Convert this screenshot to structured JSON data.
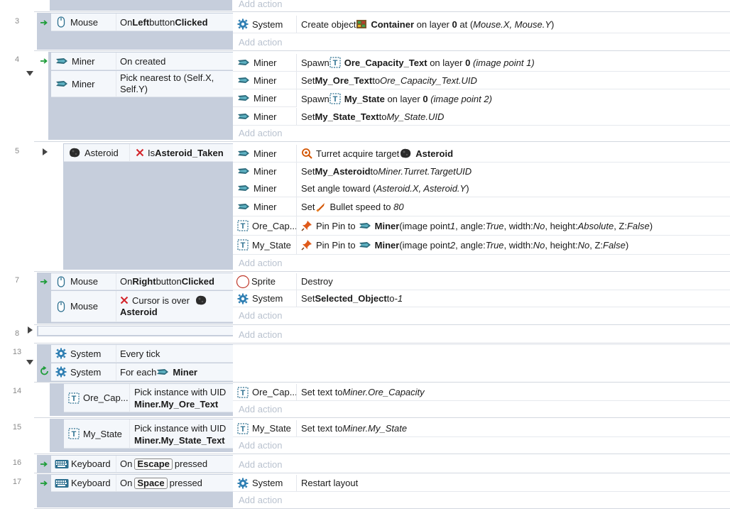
{
  "colors": {
    "accent_green": "#1f9d3a",
    "gear": "#2f7fb3",
    "add_action": "#b9c2cf",
    "line_number": "#8a8a8a"
  },
  "top_add_action": "Add action",
  "events": [
    {
      "num": "3",
      "conditions": [
        {
          "object": "Mouse",
          "icon": "mouse-icon",
          "text": [
            "On ",
            "Left",
            " button ",
            "Clicked"
          ]
        }
      ],
      "actions": [
        {
          "object": "System",
          "icon": "gear-icon",
          "text": [
            "Create object ",
            "Container",
            " on layer ",
            "0",
            " at (",
            "Mouse.X, Mouse.Y",
            ")"
          ]
        }
      ],
      "add_action": "Add action"
    },
    {
      "num": "4",
      "conditions": [
        {
          "object": "Miner",
          "icon": "miner-icon",
          "text": [
            "On created"
          ]
        },
        {
          "object": "Miner",
          "icon": "miner-icon",
          "text": [
            "Pick nearest to (Self.X, Self.Y)"
          ]
        }
      ],
      "actions": [
        {
          "object": "Miner",
          "icon": "miner-icon",
          "text": [
            "Spawn ",
            "Ore_Capacity_Text",
            " on layer ",
            "0",
            " (image point 1)"
          ]
        },
        {
          "object": "Miner",
          "icon": "miner-icon",
          "text": [
            "Set ",
            "My_Ore_Text",
            " to ",
            "Ore_Capacity_Text.UID"
          ]
        },
        {
          "object": "Miner",
          "icon": "miner-icon",
          "text": [
            "Spawn ",
            "My_State",
            " on layer ",
            "0",
            " (image point 2)"
          ]
        },
        {
          "object": "Miner",
          "icon": "miner-icon",
          "text": [
            "Set ",
            "My_State_Text",
            " to ",
            "My_State.UID"
          ]
        }
      ],
      "add_action": "Add action"
    },
    {
      "num": "5",
      "conditions": [
        {
          "object": "Asteroid",
          "icon": "asteroid-icon",
          "text": [
            "Is ",
            "Asteroid_Taken"
          ]
        }
      ],
      "actions": [
        {
          "object": "Miner",
          "icon": "miner-icon",
          "text": [
            "Turret acquire target ",
            "Asteroid"
          ]
        },
        {
          "object": "Miner",
          "icon": "miner-icon",
          "text": [
            "Set ",
            "My_Asteroid",
            " to ",
            "Miner.Turret.TargetUID"
          ]
        },
        {
          "object": "Miner",
          "icon": "miner-icon",
          "text": [
            "Set angle toward (",
            "Asteroid.X, Asteroid.Y",
            ")"
          ]
        },
        {
          "object": "Miner",
          "icon": "miner-icon",
          "text": [
            "Set ",
            "Bullet speed to ",
            "80"
          ]
        },
        {
          "object": "Ore_Cap...",
          "icon": "text-object-icon",
          "text": [
            "Pin Pin to ",
            "Miner",
            " (image point ",
            "1",
            ", angle: ",
            "True",
            ", width: ",
            "No",
            ", height: ",
            "Absolute",
            ", Z: ",
            "False",
            ")"
          ]
        },
        {
          "object": "My_State",
          "icon": "text-object-icon",
          "text": [
            "Pin Pin to ",
            "Miner",
            " (image point ",
            "2",
            ", angle: ",
            "True",
            ", width: ",
            "No",
            ", height: ",
            "No",
            ", Z: ",
            "False",
            ")"
          ]
        }
      ],
      "add_action": "Add action"
    },
    {
      "num": "7",
      "conditions": [
        {
          "object": "Mouse",
          "icon": "mouse-icon",
          "text": [
            "On ",
            "Right",
            " button ",
            "Clicked"
          ]
        },
        {
          "object": "Mouse",
          "icon": "mouse-icon",
          "text": [
            "Cursor is over ",
            "Asteroid"
          ]
        }
      ],
      "actions": [
        {
          "object": "Sprite",
          "icon": "sprite-icon",
          "text": [
            "Destroy"
          ]
        },
        {
          "object": "System",
          "icon": "gear-icon",
          "text": [
            "Set ",
            "Selected_Object",
            " to ",
            "-1"
          ]
        }
      ],
      "add_action": "Add action"
    },
    {
      "num": "8",
      "add_action": "Add action"
    },
    {
      "num": "13",
      "conditions": [
        {
          "object": "System",
          "icon": "gear-icon",
          "text": [
            "Every tick"
          ]
        },
        {
          "object": "System",
          "icon": "gear-icon",
          "text": [
            "For each ",
            "Miner"
          ]
        }
      ]
    },
    {
      "num": "14",
      "conditions": [
        {
          "object": "Ore_Cap...",
          "icon": "text-object-icon",
          "text": [
            "Pick instance with UID ",
            "Miner.My_Ore_Text"
          ]
        }
      ],
      "actions": [
        {
          "object": "Ore_Cap...",
          "icon": "text-object-icon",
          "text": [
            "Set text to ",
            "Miner.Ore_Capacity"
          ]
        }
      ],
      "add_action": "Add action"
    },
    {
      "num": "15",
      "conditions": [
        {
          "object": "My_State",
          "icon": "text-object-icon",
          "text": [
            "Pick instance with UID ",
            "Miner.My_State_Text"
          ]
        }
      ],
      "actions": [
        {
          "object": "My_State",
          "icon": "text-object-icon",
          "text": [
            "Set text to ",
            "Miner.My_State"
          ]
        }
      ],
      "add_action": "Add action"
    },
    {
      "num": "16",
      "conditions": [
        {
          "object": "Keyboard",
          "icon": "keyboard-icon",
          "text": [
            "On ",
            "Escape",
            " pressed"
          ]
        }
      ],
      "add_action": "Add action"
    },
    {
      "num": "17",
      "conditions": [
        {
          "object": "Keyboard",
          "icon": "keyboard-icon",
          "text": [
            "On ",
            "Space",
            " pressed"
          ]
        }
      ],
      "actions": [
        {
          "object": "System",
          "icon": "gear-icon",
          "text": [
            "Restart layout"
          ]
        }
      ],
      "add_action": "Add action"
    }
  ]
}
